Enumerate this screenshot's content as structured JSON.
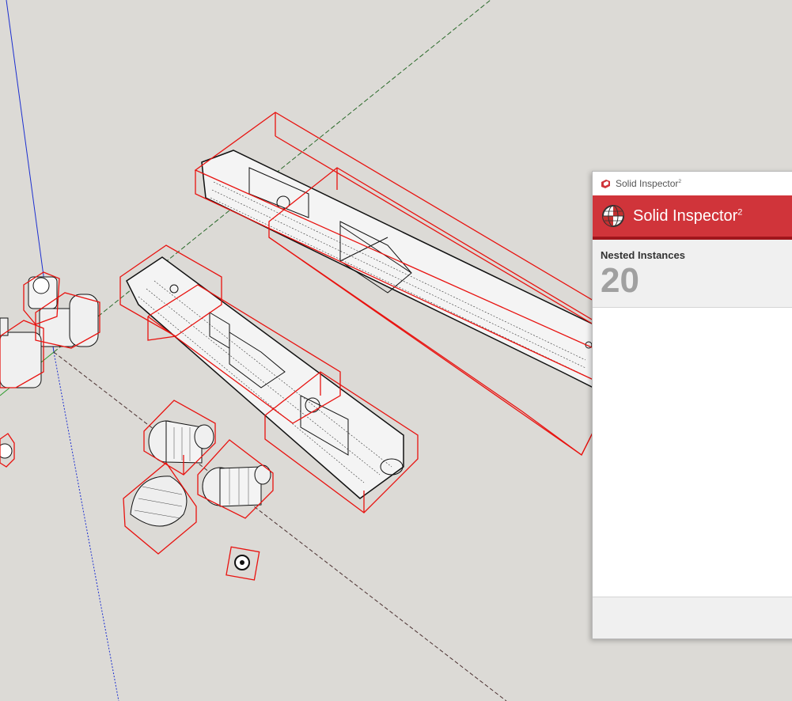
{
  "dialog": {
    "window_title": "Solid Inspector",
    "window_title_sup": "2",
    "header_title": "Solid Inspector",
    "header_title_sup": "2",
    "summary_label": "Nested Instances",
    "summary_count": "20"
  },
  "icons": {
    "window": "sketchup-icon",
    "header": "solid-inspector-globe-icon"
  },
  "colors": {
    "accent": "#d0343a",
    "accent_dark": "#a0161c",
    "selection_box": "#e8120f",
    "axis_blue": "#1c2fd0",
    "axis_green": "#2a9a2a",
    "viewport_bg": "#dcdad6"
  }
}
